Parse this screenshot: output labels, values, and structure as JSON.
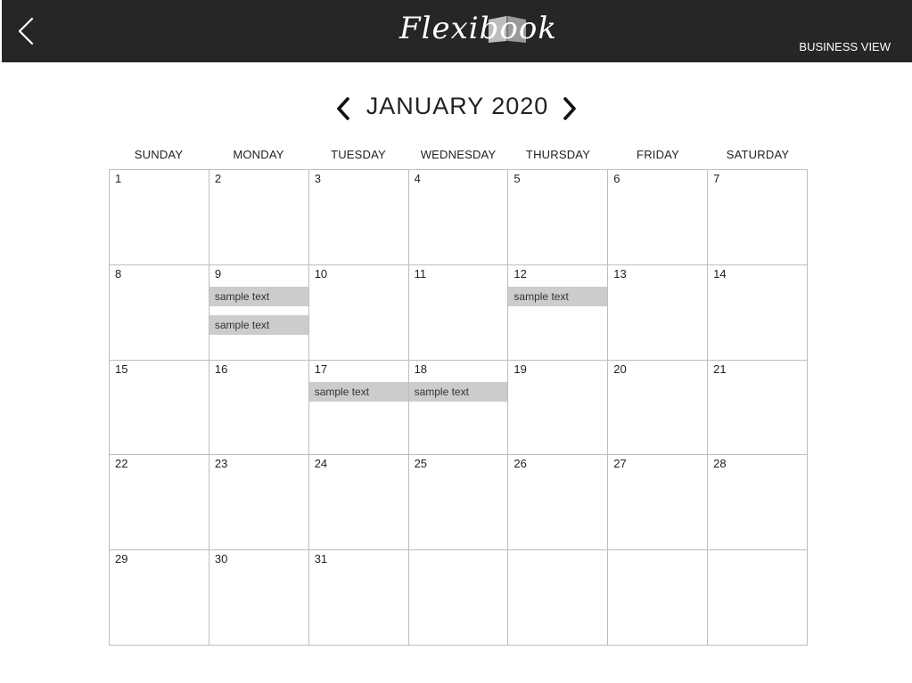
{
  "header": {
    "logo_text": "Flexibook",
    "business_view_label": "BUSINESS VIEW",
    "background_color": "#262626"
  },
  "month_nav": {
    "title": "JANUARY 2020"
  },
  "weekdays": [
    "SUNDAY",
    "MONDAY",
    "TUESDAY",
    "WEDNESDAY",
    "THURSDAY",
    "FRIDAY",
    "SATURDAY"
  ],
  "weeks": [
    [
      {
        "day": "1",
        "events": []
      },
      {
        "day": "2",
        "events": []
      },
      {
        "day": "3",
        "events": []
      },
      {
        "day": "4",
        "events": []
      },
      {
        "day": "5",
        "events": []
      },
      {
        "day": "6",
        "events": []
      },
      {
        "day": "7",
        "events": []
      }
    ],
    [
      {
        "day": "8",
        "events": []
      },
      {
        "day": "9",
        "events": [
          "sample text",
          "sample text"
        ]
      },
      {
        "day": "10",
        "events": []
      },
      {
        "day": "11",
        "events": []
      },
      {
        "day": "12",
        "events": [
          "sample text"
        ]
      },
      {
        "day": "13",
        "events": []
      },
      {
        "day": "14",
        "events": []
      }
    ],
    [
      {
        "day": "15",
        "events": []
      },
      {
        "day": "16",
        "events": []
      },
      {
        "day": "17",
        "events": [
          "sample text"
        ]
      },
      {
        "day": "18",
        "events": [
          "sample text"
        ]
      },
      {
        "day": "19",
        "events": []
      },
      {
        "day": "20",
        "events": []
      },
      {
        "day": "21",
        "events": []
      }
    ],
    [
      {
        "day": "22",
        "events": []
      },
      {
        "day": "23",
        "events": []
      },
      {
        "day": "24",
        "events": []
      },
      {
        "day": "25",
        "events": []
      },
      {
        "day": "26",
        "events": []
      },
      {
        "day": "27",
        "events": []
      },
      {
        "day": "28",
        "events": []
      }
    ],
    [
      {
        "day": "29",
        "events": []
      },
      {
        "day": "30",
        "events": []
      },
      {
        "day": "31",
        "events": []
      },
      {
        "day": "",
        "events": []
      },
      {
        "day": "",
        "events": []
      },
      {
        "day": "",
        "events": []
      },
      {
        "day": "",
        "events": []
      }
    ]
  ],
  "colors": {
    "event_background": "#cccccc",
    "grid_line": "#bdbdbd"
  },
  "icons": {
    "back": "chevron-left-icon",
    "prev_month": "chevron-left-icon",
    "next_month": "chevron-right-icon",
    "logo_book": "book-icon"
  }
}
